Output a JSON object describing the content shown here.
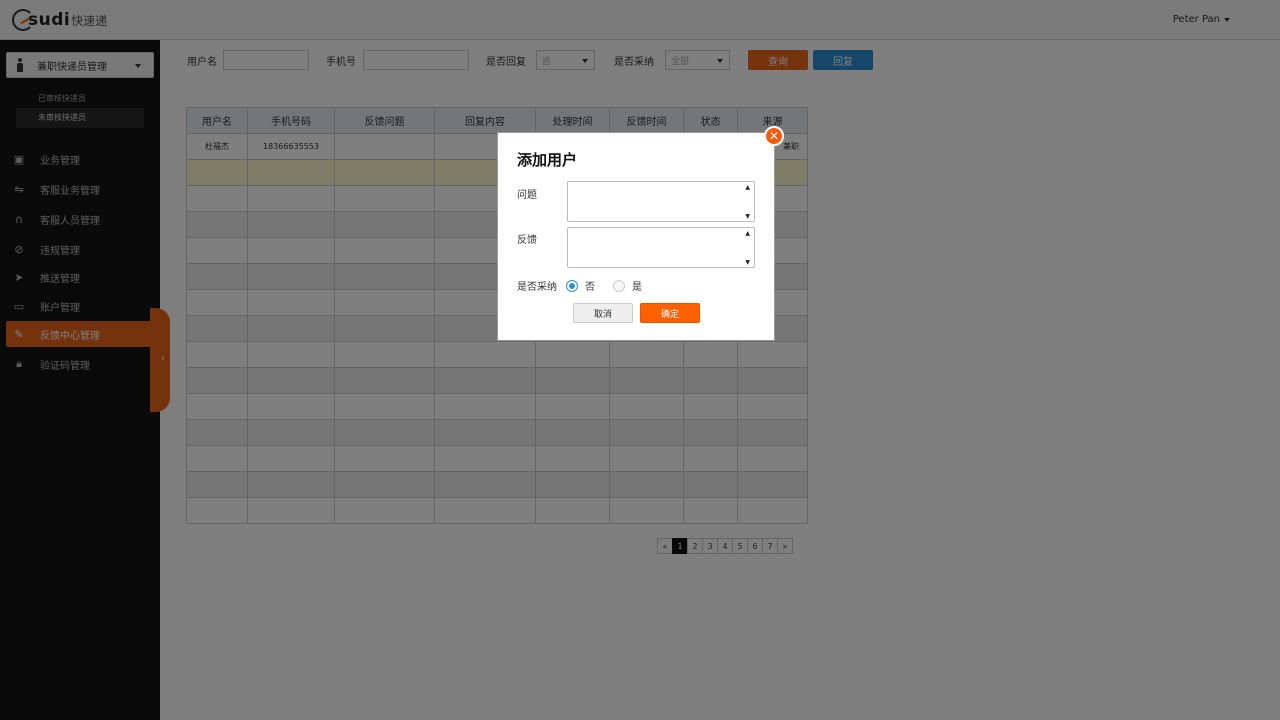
{
  "header": {
    "logo_text": "sudi",
    "logo_cn": "快速递",
    "user_name": "Peter Pan"
  },
  "sidebar": {
    "select_label": "兼职快递员管理",
    "sub_items": [
      {
        "label": "已审核快递员"
      },
      {
        "label": "未审核快递员"
      }
    ],
    "nav_items": [
      {
        "label": "业务管理",
        "icon": "briefcase-icon"
      },
      {
        "label": "客服业务管理",
        "icon": "handshake-icon"
      },
      {
        "label": "客服人员管理",
        "icon": "headset-icon"
      },
      {
        "label": "违规管理",
        "icon": "ban-icon"
      },
      {
        "label": "推送管理",
        "icon": "paper-plane-icon"
      },
      {
        "label": "账户管理",
        "icon": "credit-card-icon"
      },
      {
        "label": "反馈中心管理",
        "icon": "edit-icon"
      },
      {
        "label": "验证码管理",
        "icon": "lock-icon"
      }
    ]
  },
  "filters": {
    "username_label": "用户名",
    "phone_label": "手机号",
    "replied_label": "是否回复",
    "replied_value": "否",
    "adopted_label": "是否采纳",
    "adopted_value": "全部",
    "query_button": "查询",
    "reply_button": "回复"
  },
  "table": {
    "headers": [
      "用户名",
      "手机号码",
      "反馈问题",
      "回复内容",
      "处理时间",
      "反馈时间",
      "状态",
      "来源"
    ],
    "first_row": [
      "杜福杰",
      "18366635553",
      "",
      "",
      "",
      "",
      "",
      "兼职"
    ]
  },
  "pagination": {
    "prev": "«",
    "pages": [
      "1",
      "2",
      "3",
      "4",
      "5",
      "6",
      "7"
    ],
    "next": "»",
    "current": "1"
  },
  "modal": {
    "title": "添加用户",
    "question_label": "问题",
    "feedback_label": "反馈",
    "adopted_label": "是否采纳",
    "option_no": "否",
    "option_yes": "是",
    "cancel_button": "取消",
    "confirm_button": "确定",
    "close_symbol": "✕"
  },
  "colors": {
    "accent": "#e8641a",
    "primary": "#2c8ed6",
    "sidebar_bg": "#151515"
  }
}
